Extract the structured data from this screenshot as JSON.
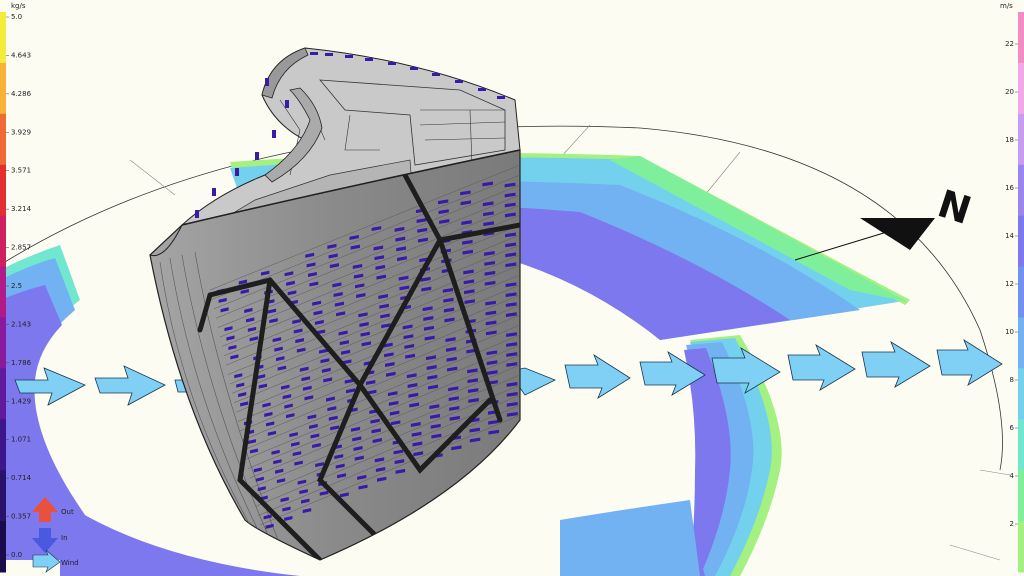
{
  "left_scale": {
    "unit": "kg/s",
    "ticks": [
      "5.0",
      "4.643",
      "4.286",
      "3.929",
      "3.571",
      "3.214",
      "2.857",
      "2.5",
      "2.143",
      "1.786",
      "1.429",
      "1.071",
      "0.714",
      "0.357",
      "0.0"
    ],
    "colors": [
      "#f4ec3a",
      "#f7b23a",
      "#f06a35",
      "#e22f2f",
      "#d1205e",
      "#b21a8a",
      "#8c1a9e",
      "#61199e",
      "#3d168e",
      "#2a126c",
      "#1a0c4a"
    ]
  },
  "right_scale": {
    "unit": "m/s",
    "ticks": [
      "22",
      "20",
      "18",
      "16",
      "14",
      "12",
      "10",
      "8",
      "6",
      "4",
      "2"
    ],
    "colors": [
      "#f28cc4",
      "#f2a7ea",
      "#c79cf3",
      "#9b86f0",
      "#7d78ee",
      "#7391f0",
      "#73b2f2",
      "#74d1ee",
      "#71e7cf",
      "#7fef9c",
      "#a4f080"
    ]
  },
  "legend": {
    "out_label": "Out",
    "in_label": "In",
    "wind_label": "Wind",
    "out_color": "#e8513c",
    "in_color": "#4a5ae0",
    "wind_color": "#7fd0f4"
  },
  "compass": {
    "north_label": "N"
  },
  "colors": {
    "background": "#fdfcf3",
    "facade": "#8e8e8e",
    "window": "#3a1aa8",
    "brace": "#222222"
  }
}
